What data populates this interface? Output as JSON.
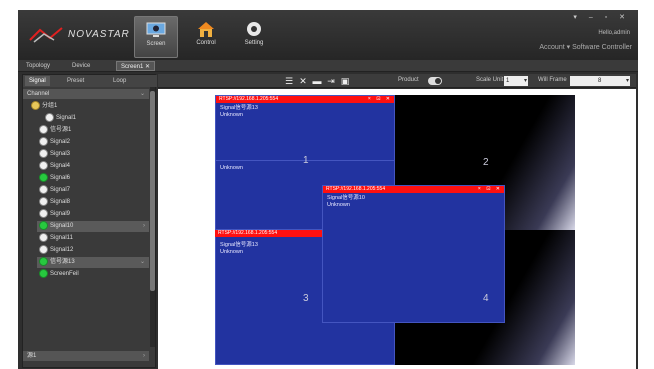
{
  "header": {
    "logo_text": "NOVASTAR",
    "nav": [
      {
        "label": "Screen",
        "icon": "monitor-icon",
        "active": true
      },
      {
        "label": "Control",
        "icon": "home-icon",
        "active": false
      },
      {
        "label": "Setting",
        "icon": "gear-icon",
        "active": false
      }
    ],
    "window_controls": "▾ – ▫ ✕",
    "user": "Hello,admin",
    "title": "Account ▾ Software Controller"
  },
  "tabs": [
    {
      "label": "Topology"
    },
    {
      "label": "Device"
    },
    {
      "label": "Screen1",
      "active": true,
      "close": "✕"
    }
  ],
  "left_panel": {
    "subtabs": [
      {
        "label": "Signal",
        "active": true
      },
      {
        "label": "Preset"
      },
      {
        "label": "Loop"
      }
    ],
    "group_header": "Channel",
    "group_chevron": "⌄",
    "subgroup": "分组1",
    "items": [
      {
        "label": "Signal1",
        "dot": "white"
      },
      {
        "label": "信号源1",
        "dot": "white"
      },
      {
        "label": "Signal2",
        "dot": "white"
      },
      {
        "label": "Signal3",
        "dot": "white"
      },
      {
        "label": "Signal4",
        "dot": "white"
      },
      {
        "label": "Signal6",
        "dot": "green"
      },
      {
        "label": "Signal7",
        "dot": "white"
      },
      {
        "label": "Signal8",
        "dot": "white"
      },
      {
        "label": "Signal9",
        "dot": "white"
      },
      {
        "label": "Signal10",
        "dot": "green",
        "selected": true
      },
      {
        "label": "Signal11",
        "dot": "white"
      },
      {
        "label": "Signal12",
        "dot": "white"
      },
      {
        "label": "信号源13",
        "dot": "green",
        "selected": true
      },
      {
        "label": "ScreenFeil",
        "dot": "green"
      }
    ],
    "bottom_group": "源1"
  },
  "toolbar": {
    "icons": [
      "menu-icon",
      "close-icon",
      "lock-icon",
      "export-icon",
      "image-icon"
    ],
    "icon_glyphs": [
      "☰",
      "✕",
      "▬",
      "⇥",
      "▣"
    ],
    "product_label": "Product",
    "scale_label": "Scale Unit",
    "scale_value": "1",
    "fill_label": "Will Frame",
    "fill_value": "8"
  },
  "canvas": {
    "windows": [
      {
        "title": "RTSP://192.168.1.205:554",
        "lines": [
          "Signal信号源13",
          "Unknown"
        ]
      },
      {
        "title": "RTSP://192.168.1.205:554",
        "lines": [
          "Signal信号源10",
          "Unknown"
        ]
      },
      {
        "title": "RTSP://192.168.1.205:554",
        "lines": [
          "Signal信号源13",
          "Unknown"
        ]
      }
    ],
    "quad_labels": [
      "1",
      "2",
      "3",
      "4"
    ],
    "unknown": "Unknown",
    "win_ctrls": "× ⊡ ✕"
  },
  "colors": {
    "window_bg": "#2233a0",
    "title_red": "#ff1010",
    "signal_green": "#27c93f"
  }
}
